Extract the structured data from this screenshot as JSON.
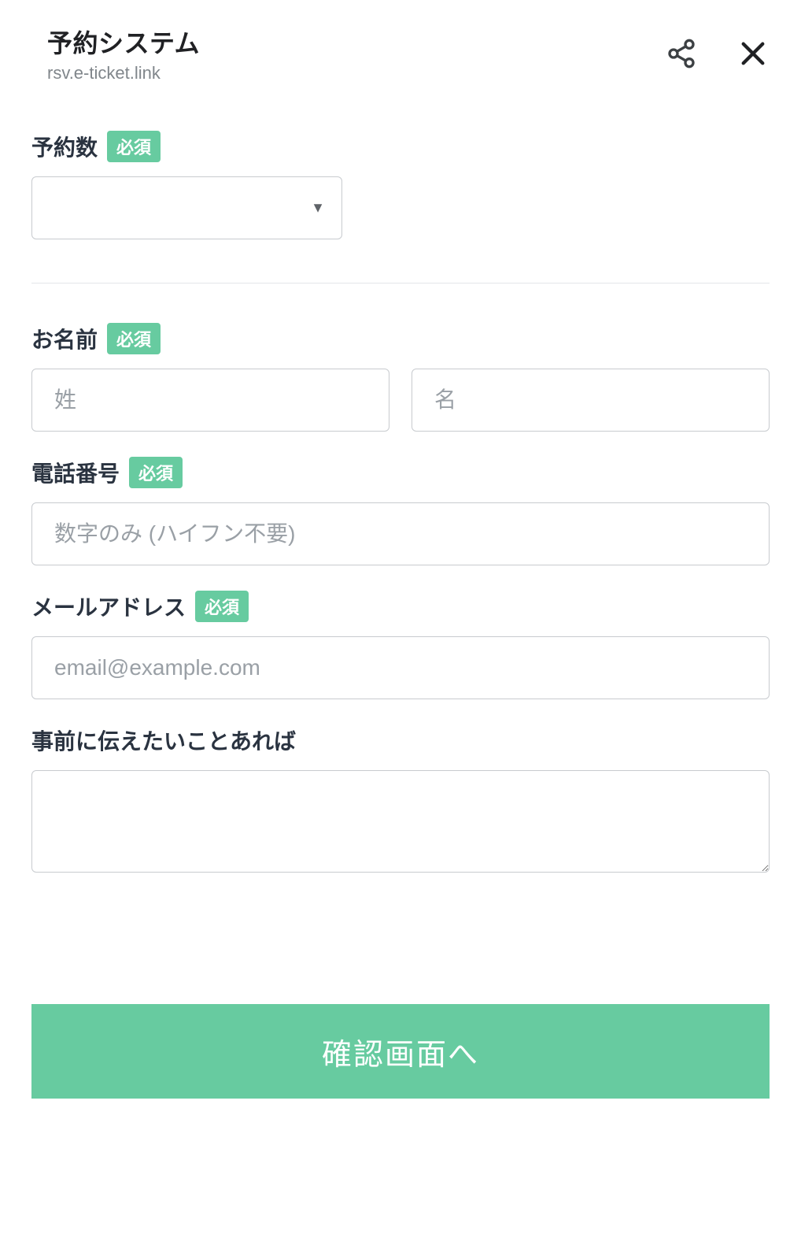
{
  "header": {
    "title": "予約システム",
    "subtitle": "rsv.e-ticket.link"
  },
  "form": {
    "reservation_count": {
      "label": "予約数",
      "required_badge": "必須"
    },
    "name": {
      "label": "お名前",
      "required_badge": "必須",
      "last_name_placeholder": "姓",
      "first_name_placeholder": "名"
    },
    "phone": {
      "label": "電話番号",
      "required_badge": "必須",
      "placeholder": "数字のみ (ハイフン不要)"
    },
    "email": {
      "label": "メールアドレス",
      "required_badge": "必須",
      "placeholder": "email@example.com"
    },
    "message": {
      "label": "事前に伝えたいことあれば"
    },
    "submit_label": "確認画面へ"
  }
}
